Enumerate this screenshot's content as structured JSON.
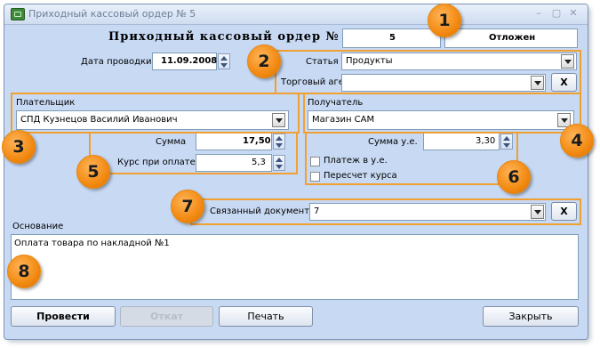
{
  "window": {
    "title": "Приходный кассовый ордер № 5",
    "heading": "Приходный кассовый ордер №",
    "number": "5",
    "status": "Отложен"
  },
  "date": {
    "label": "Дата проводки",
    "value": "11.09.2008"
  },
  "article": {
    "label": "Статья",
    "value": "Продукты"
  },
  "agent": {
    "label": "Торговый агент",
    "value": "",
    "clear": "X"
  },
  "payer": {
    "label": "Плательщик",
    "value": "СПД Кузнецов Василий Иванович"
  },
  "recipient": {
    "label": "Получатель",
    "value": "Магазин САМ"
  },
  "amount": {
    "label": "Сумма",
    "value": "17,50"
  },
  "rate": {
    "label": "Курс при оплате",
    "value": "5,3"
  },
  "amount_ue": {
    "label": "Сумма у.е.",
    "value": "3,30"
  },
  "checks": {
    "payment_ue": "Платеж в у.е.",
    "recalc": "Пересчет курса"
  },
  "linked": {
    "label": "Связанный документ",
    "value": "7",
    "clear": "X"
  },
  "basis": {
    "label": "Основание",
    "text": "Оплата товара по накладной №1"
  },
  "buttons": {
    "post": "Провести",
    "rollback": "Откат",
    "print": "Печать",
    "close": "Закрыть"
  },
  "badges": [
    "1",
    "2",
    "3",
    "4",
    "5",
    "6",
    "7",
    "8"
  ],
  "colors": {
    "accent": "#f0a030",
    "window_bg": "#c8d9f3"
  }
}
